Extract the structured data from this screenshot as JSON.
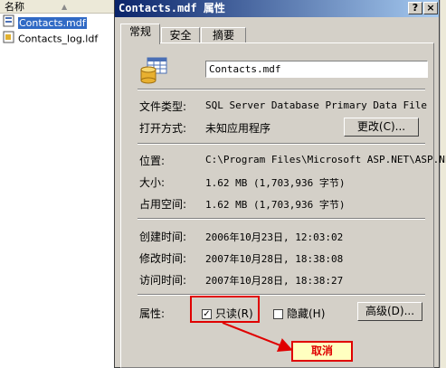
{
  "explorer": {
    "column_header": "名称",
    "files": [
      {
        "name": "Contacts.mdf",
        "selected": true,
        "icon": "mdf-file-icon"
      },
      {
        "name": "Contacts_log.ldf",
        "selected": false,
        "icon": "ldf-file-icon"
      }
    ]
  },
  "dialog": {
    "title": "Contacts.mdf 属性",
    "help_button": "?",
    "close_button": "×",
    "tabs": [
      {
        "label": "常规",
        "active": true
      },
      {
        "label": "安全",
        "active": false
      },
      {
        "label": "摘要",
        "active": false
      }
    ],
    "file_name": "Contacts.mdf",
    "file_type_label": "文件类型:",
    "file_type_value": "SQL Server Database Primary Data File",
    "opens_with_label": "打开方式:",
    "opens_with_value": "未知应用程序",
    "change_button": "更改(C)...",
    "location_label": "位置:",
    "location_value": "C:\\Program Files\\Microsoft ASP.NET\\ASP.NE",
    "size_label": "大小:",
    "size_value": "1.62 MB (1,703,936 字节)",
    "size_on_disk_label": "占用空间:",
    "size_on_disk_value": "1.62 MB (1,703,936 字节)",
    "created_label": "创建时间:",
    "created_value": "2006年10月23日, 12:03:02",
    "modified_label": "修改时间:",
    "modified_value": "2007年10月28日, 18:38:08",
    "accessed_label": "访问时间:",
    "accessed_value": "2007年10月28日, 18:38:27",
    "attributes_label": "属性:",
    "readonly_label": "只读(R)",
    "readonly_checked": true,
    "hidden_label": "隐藏(H)",
    "hidden_checked": false,
    "advanced_button": "高级(D)..."
  },
  "annotation": {
    "cancel_label": "取消",
    "color": "#e00000"
  }
}
